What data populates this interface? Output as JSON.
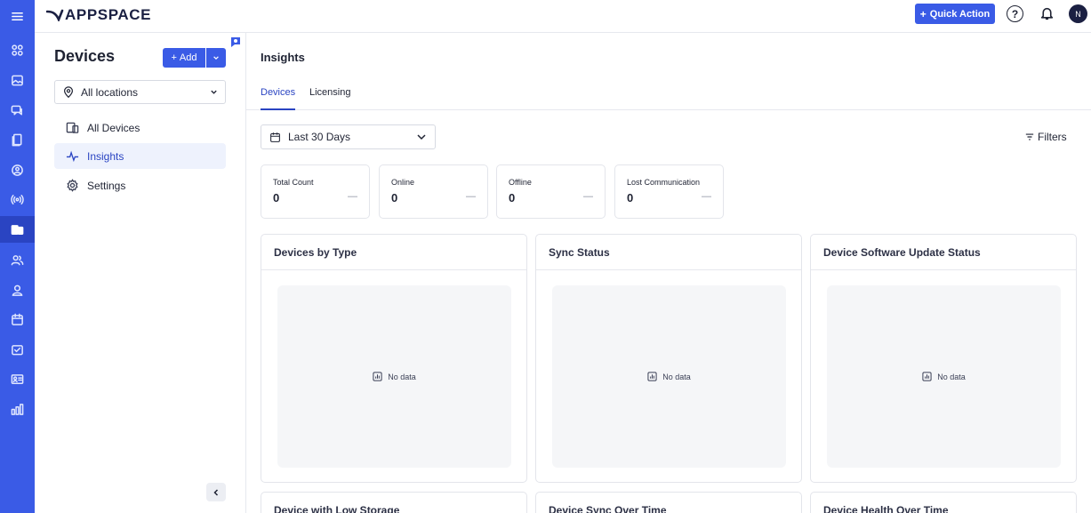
{
  "topbar": {
    "logo": "APPSPACE",
    "quick_action_label": "Quick Action",
    "help_symbol": "?",
    "avatar_initial": "N"
  },
  "rail": {
    "icons": [
      "menu-icon",
      "dashboard-icon",
      "image-icon",
      "chat-icon",
      "content-icon",
      "channels-icon",
      "broadcast-icon",
      "devices-icon",
      "people-icon",
      "user-icon",
      "calendar-icon",
      "inbox-icon",
      "badge-icon",
      "analytics-icon"
    ],
    "active": "devices-icon"
  },
  "left_panel": {
    "title": "Devices",
    "add_label": "Add",
    "location_select": "All locations",
    "nav": [
      {
        "label": "All Devices",
        "icon": "devices-icon"
      },
      {
        "label": "Insights",
        "icon": "pulse-icon",
        "active": true
      },
      {
        "label": "Settings",
        "icon": "gear-icon"
      }
    ]
  },
  "main": {
    "title": "Insights",
    "tabs": [
      {
        "label": "Devices",
        "active": true
      },
      {
        "label": "Licensing",
        "active": false
      }
    ],
    "date_range": "Last 30 Days",
    "filters_label": "Filters",
    "stats": [
      {
        "label": "Total Count",
        "value": "0",
        "trend": "—"
      },
      {
        "label": "Online",
        "value": "0",
        "trend": "—"
      },
      {
        "label": "Offline",
        "value": "0",
        "trend": "—"
      },
      {
        "label": "Lost Communication",
        "value": "0",
        "trend": "—"
      }
    ],
    "cards": [
      {
        "title": "Devices by Type",
        "empty": "No data"
      },
      {
        "title": "Sync Status",
        "empty": "No data"
      },
      {
        "title": "Device Software Update Status",
        "empty": "No data"
      }
    ],
    "cards_row2": [
      {
        "title": "Device with Low Storage"
      },
      {
        "title": "Device Sync Over Time"
      },
      {
        "title": "Device Health Over Time"
      }
    ]
  },
  "colors": {
    "accent": "#3a5be6",
    "rail_active": "#2a44c2",
    "text": "#1f2333"
  }
}
